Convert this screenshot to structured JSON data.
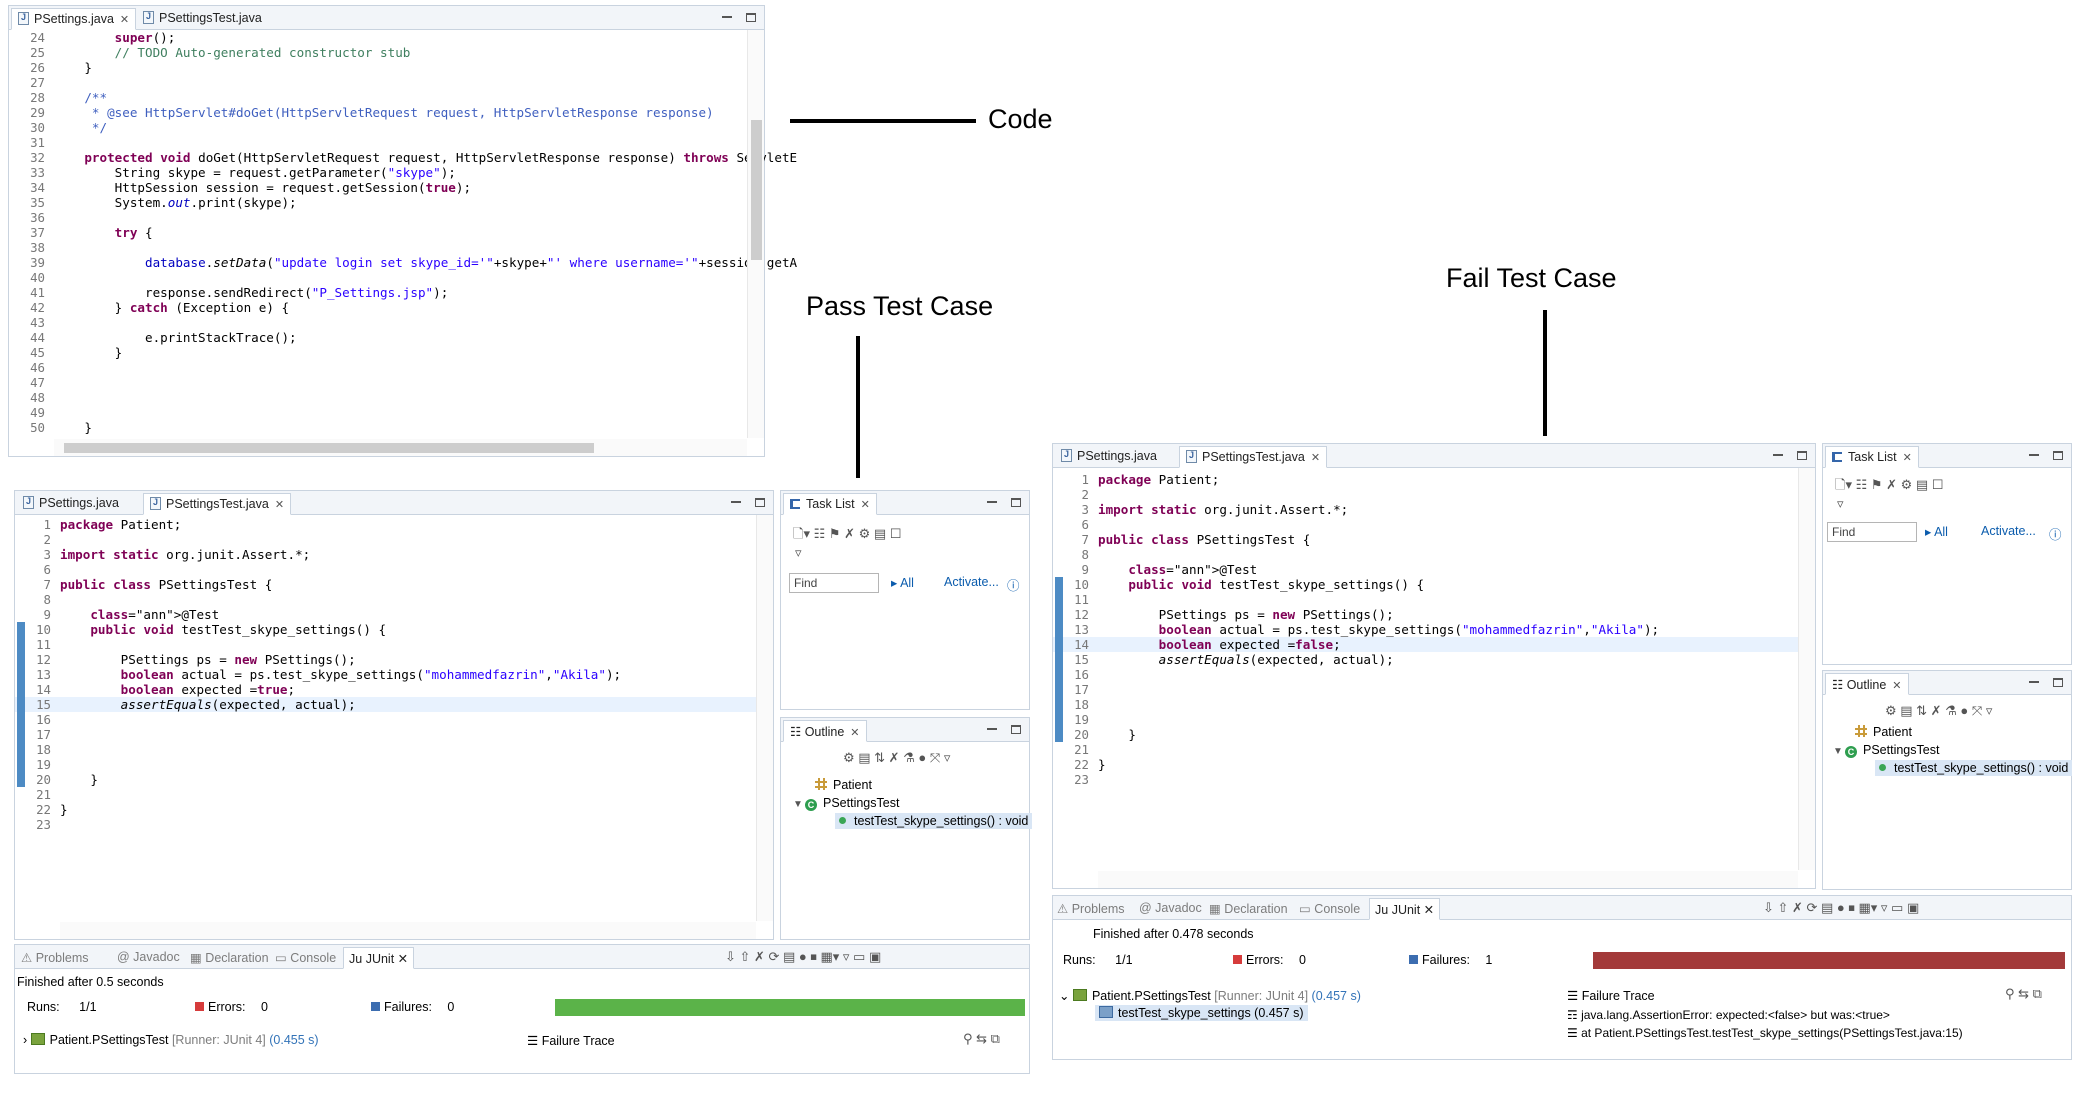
{
  "annotations": {
    "code": "Code",
    "pass": "Pass Test Case",
    "fail": "Fail Test Case"
  },
  "code_editor": {
    "tabs": [
      "PSettings.java",
      "PSettingsTest.java"
    ],
    "lines": [
      {
        "n": "24",
        "t": "        super();"
      },
      {
        "n": "25",
        "t": "        // TODO Auto-generated constructor stub"
      },
      {
        "n": "26",
        "t": "    }"
      },
      {
        "n": "27",
        "t": ""
      },
      {
        "n": "28",
        "t": "    /**"
      },
      {
        "n": "29",
        "t": "     * @see HttpServlet#doGet(HttpServletRequest request, HttpServletResponse response)"
      },
      {
        "n": "30",
        "t": "     */"
      },
      {
        "n": "31",
        "t": ""
      },
      {
        "n": "32",
        "t": "    protected void doGet(HttpServletRequest request, HttpServletResponse response) throws ServletE"
      },
      {
        "n": "33",
        "t": "        String skype = request.getParameter(\"skype\");"
      },
      {
        "n": "34",
        "t": "        HttpSession session = request.getSession(true);"
      },
      {
        "n": "35",
        "t": "        System.out.print(skype);"
      },
      {
        "n": "36",
        "t": ""
      },
      {
        "n": "37",
        "t": "        try {"
      },
      {
        "n": "38",
        "t": ""
      },
      {
        "n": "39",
        "t": "            database.setData(\"update login set skype_id='\"+skype+\"' where username='\"+session.getA"
      },
      {
        "n": "40",
        "t": ""
      },
      {
        "n": "41",
        "t": "            response.sendRedirect(\"P_Settings.jsp\");"
      },
      {
        "n": "42",
        "t": "        } catch (Exception e) {"
      },
      {
        "n": "43",
        "t": ""
      },
      {
        "n": "44",
        "t": "            e.printStackTrace();"
      },
      {
        "n": "45",
        "t": "        }"
      },
      {
        "n": "46",
        "t": ""
      },
      {
        "n": "47",
        "t": ""
      },
      {
        "n": "48",
        "t": ""
      },
      {
        "n": "49",
        "t": ""
      },
      {
        "n": "50",
        "t": "    }"
      }
    ]
  },
  "pass_panel": {
    "tabs": [
      "PSettings.java",
      "PSettingsTest.java"
    ],
    "lines": [
      {
        "n": "1",
        "t": "package Patient;"
      },
      {
        "n": "2",
        "t": ""
      },
      {
        "n": "3",
        "t": "import static org.junit.Assert.*;"
      },
      {
        "n": "6",
        "t": ""
      },
      {
        "n": "7",
        "t": "public class PSettingsTest {"
      },
      {
        "n": "8",
        "t": ""
      },
      {
        "n": "9",
        "t": "    @Test"
      },
      {
        "n": "10",
        "t": "    public void testTest_skype_settings() {"
      },
      {
        "n": "11",
        "t": ""
      },
      {
        "n": "12",
        "t": "        PSettings ps = new PSettings();"
      },
      {
        "n": "13",
        "t": "        boolean actual = ps.test_skype_settings(\"mohammedfazrin\",\"Akila\");"
      },
      {
        "n": "14",
        "t": "        boolean expected =true;"
      },
      {
        "n": "15",
        "t": "        assertEquals(expected, actual);"
      },
      {
        "n": "16",
        "t": ""
      },
      {
        "n": "17",
        "t": ""
      },
      {
        "n": "18",
        "t": ""
      },
      {
        "n": "19",
        "t": ""
      },
      {
        "n": "20",
        "t": "    }"
      },
      {
        "n": "21",
        "t": ""
      },
      {
        "n": "22",
        "t": "}"
      },
      {
        "n": "23",
        "t": ""
      }
    ],
    "tasklist": {
      "title": "Task List",
      "find": "Find",
      "all": "All",
      "activate": "Activate..."
    },
    "outline": {
      "title": "Outline",
      "pkg": "Patient",
      "cls": "PSettingsTest",
      "method": "testTest_skype_settings() : void"
    },
    "junit": {
      "tabs": [
        "Problems",
        "Javadoc",
        "Declaration",
        "Console",
        "JUnit"
      ],
      "finished": "Finished after 0.5 seconds",
      "runs_label": "Runs:",
      "runs": "1/1",
      "errors_label": "Errors:",
      "errors": "0",
      "failures_label": "Failures:",
      "failures": "0",
      "bar_color": "#5bb349",
      "tree_root": "Patient.PSettingsTest",
      "tree_root_meta": "[Runner: JUnit 4]",
      "tree_root_time": "(0.455 s)",
      "failure_trace": "Failure Trace"
    }
  },
  "fail_panel": {
    "tabs": [
      "PSettings.java",
      "PSettingsTest.java"
    ],
    "lines": [
      {
        "n": "1",
        "t": "package Patient;"
      },
      {
        "n": "2",
        "t": ""
      },
      {
        "n": "3",
        "t": "import static org.junit.Assert.*;"
      },
      {
        "n": "6",
        "t": ""
      },
      {
        "n": "7",
        "t": "public class PSettingsTest {"
      },
      {
        "n": "8",
        "t": ""
      },
      {
        "n": "9",
        "t": "    @Test"
      },
      {
        "n": "10",
        "t": "    public void testTest_skype_settings() {"
      },
      {
        "n": "11",
        "t": ""
      },
      {
        "n": "12",
        "t": "        PSettings ps = new PSettings();"
      },
      {
        "n": "13",
        "t": "        boolean actual = ps.test_skype_settings(\"mohammedfazrin\",\"Akila\");"
      },
      {
        "n": "14",
        "t": "        boolean expected =false;"
      },
      {
        "n": "15",
        "t": "        assertEquals(expected, actual);"
      },
      {
        "n": "16",
        "t": ""
      },
      {
        "n": "17",
        "t": ""
      },
      {
        "n": "18",
        "t": ""
      },
      {
        "n": "19",
        "t": ""
      },
      {
        "n": "20",
        "t": "    }"
      },
      {
        "n": "21",
        "t": ""
      },
      {
        "n": "22",
        "t": "}"
      },
      {
        "n": "23",
        "t": ""
      }
    ],
    "tasklist": {
      "title": "Task List",
      "find": "Find",
      "all": "All",
      "activate": "Activate..."
    },
    "outline": {
      "title": "Outline",
      "pkg": "Patient",
      "cls": "PSettingsTest",
      "method": "testTest_skype_settings() : void"
    },
    "junit": {
      "tabs": [
        "Problems",
        "Javadoc",
        "Declaration",
        "Console",
        "JUnit"
      ],
      "finished": "Finished after 0.478 seconds",
      "runs_label": "Runs:",
      "runs": "1/1",
      "errors_label": "Errors:",
      "errors": "0",
      "failures_label": "Failures:",
      "failures": "1",
      "bar_color": "#a33a3a",
      "tree_root": "Patient.PSettingsTest",
      "tree_root_meta": "[Runner: JUnit 4]",
      "tree_root_time": "(0.457 s)",
      "tree_child": "testTest_skype_settings (0.457 s)",
      "failure_trace": "Failure Trace",
      "trace_1": "java.lang.AssertionError: expected:<false> but was:<true>",
      "trace_2": "at Patient.PSettingsTest.testTest_skype_settings(PSettingsTest.java:15)"
    }
  }
}
